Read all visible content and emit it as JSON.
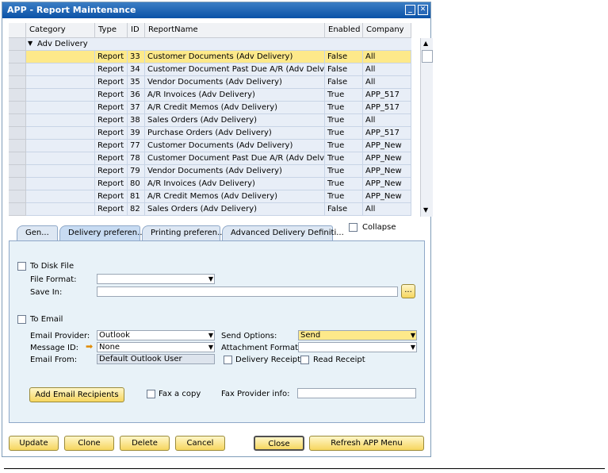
{
  "window": {
    "title": "APP - Report Maintenance"
  },
  "grid": {
    "columns": [
      "Category",
      "Type",
      "ID",
      "ReportName",
      "Enabled",
      "Company"
    ],
    "group_label": "Adv Delivery",
    "rows": [
      {
        "type": "Report",
        "id": "33",
        "name": "Customer Documents  (Adv Delivery)",
        "enabled": "False",
        "company": "All"
      },
      {
        "type": "Report",
        "id": "34",
        "name": "Customer Document Past Due A/R (Adv Delv)",
        "enabled": "False",
        "company": "All"
      },
      {
        "type": "Report",
        "id": "35",
        "name": "Vendor Documents (Adv Delivery)",
        "enabled": "False",
        "company": "All"
      },
      {
        "type": "Report",
        "id": "36",
        "name": "A/R Invoices (Adv Delivery)",
        "enabled": "True",
        "company": "APP_517"
      },
      {
        "type": "Report",
        "id": "37",
        "name": "A/R Credit Memos (Adv Delivery)",
        "enabled": "True",
        "company": "APP_517"
      },
      {
        "type": "Report",
        "id": "38",
        "name": "Sales Orders (Adv Delivery)",
        "enabled": "True",
        "company": "All"
      },
      {
        "type": "Report",
        "id": "39",
        "name": "Purchase Orders (Adv Delivery)",
        "enabled": "True",
        "company": "APP_517"
      },
      {
        "type": "Report",
        "id": "77",
        "name": "Customer Documents  (Adv Delivery)",
        "enabled": "True",
        "company": "APP_New"
      },
      {
        "type": "Report",
        "id": "78",
        "name": "Customer Document Past Due A/R (Adv Delv)",
        "enabled": "True",
        "company": "APP_New"
      },
      {
        "type": "Report",
        "id": "79",
        "name": "Vendor Documents (Adv Delivery)",
        "enabled": "True",
        "company": "APP_New"
      },
      {
        "type": "Report",
        "id": "80",
        "name": "A/R Invoices (Adv Delivery)",
        "enabled": "True",
        "company": "APP_New"
      },
      {
        "type": "Report",
        "id": "81",
        "name": "A/R Credit Memos (Adv Delivery)",
        "enabled": "True",
        "company": "APP_New"
      },
      {
        "type": "Report",
        "id": "82",
        "name": "Sales Orders (Adv Delivery)",
        "enabled": "False",
        "company": "All"
      }
    ]
  },
  "tabs": [
    "Gen...",
    "Delivery preferen...",
    "Printing preferen...",
    "Advanced Delivery Definiti..."
  ],
  "collapse_label": "Collapse",
  "disk": {
    "label": "To Disk File",
    "file_format_label": "File Format:",
    "file_format_value": "",
    "save_in_label": "Save In:",
    "save_in_value": "",
    "browse_label": "..."
  },
  "email": {
    "label": "To Email",
    "provider_label": "Email Provider:",
    "provider_value": "Outlook",
    "message_id_label": "Message ID:",
    "message_id_value": "None",
    "email_from_label": "Email From:",
    "email_from_value": "Default Outlook User",
    "send_options_label": "Send Options:",
    "send_options_value": "Send",
    "attachment_format_label": "Attachment Format:",
    "attachment_format_value": "",
    "delivery_receipt_label": "Delivery Receipt",
    "read_receipt_label": "Read Receipt"
  },
  "recipients_button": "Add Email Recipients",
  "fax": {
    "fax_copy_label": "Fax a copy",
    "provider_info_label": "Fax Provider info:",
    "provider_info_value": ""
  },
  "buttons": {
    "update": "Update",
    "clone": "Clone",
    "delete": "Delete",
    "cancel": "Cancel",
    "close": "Close",
    "refresh": "Refresh APP Menu"
  },
  "colors": {
    "selected_row": "#fde98a",
    "row": "#e8eef7",
    "title_bar": "#0a52a7"
  }
}
